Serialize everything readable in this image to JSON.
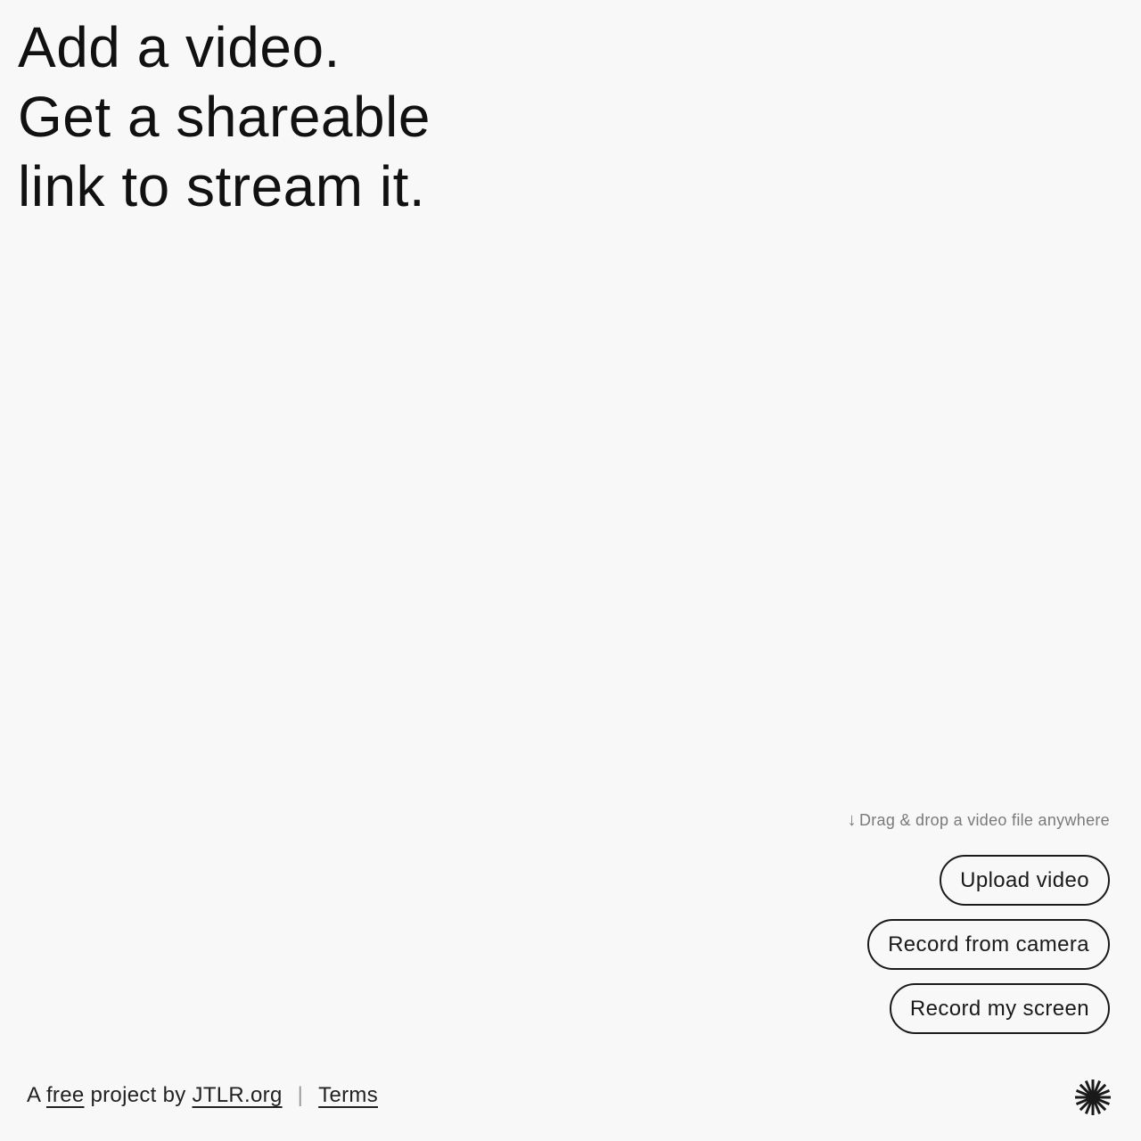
{
  "headline": {
    "lines": [
      "Add a video.",
      "Get a shareable",
      "link to stream it."
    ]
  },
  "actions": {
    "drop_arrow": "↓",
    "drop_hint": "Drag & drop a video file anywhere",
    "upload_label": "Upload video",
    "camera_label": "Record from camera",
    "screen_label": "Record my screen"
  },
  "footer": {
    "prefix": "A",
    "free_link": "free",
    "middle": "project by",
    "org_link": "JTLR.org",
    "separator": "|",
    "terms_link": "Terms"
  },
  "logo": {
    "icon": "asterisk-burst-icon",
    "color": "#1a1a1a"
  }
}
